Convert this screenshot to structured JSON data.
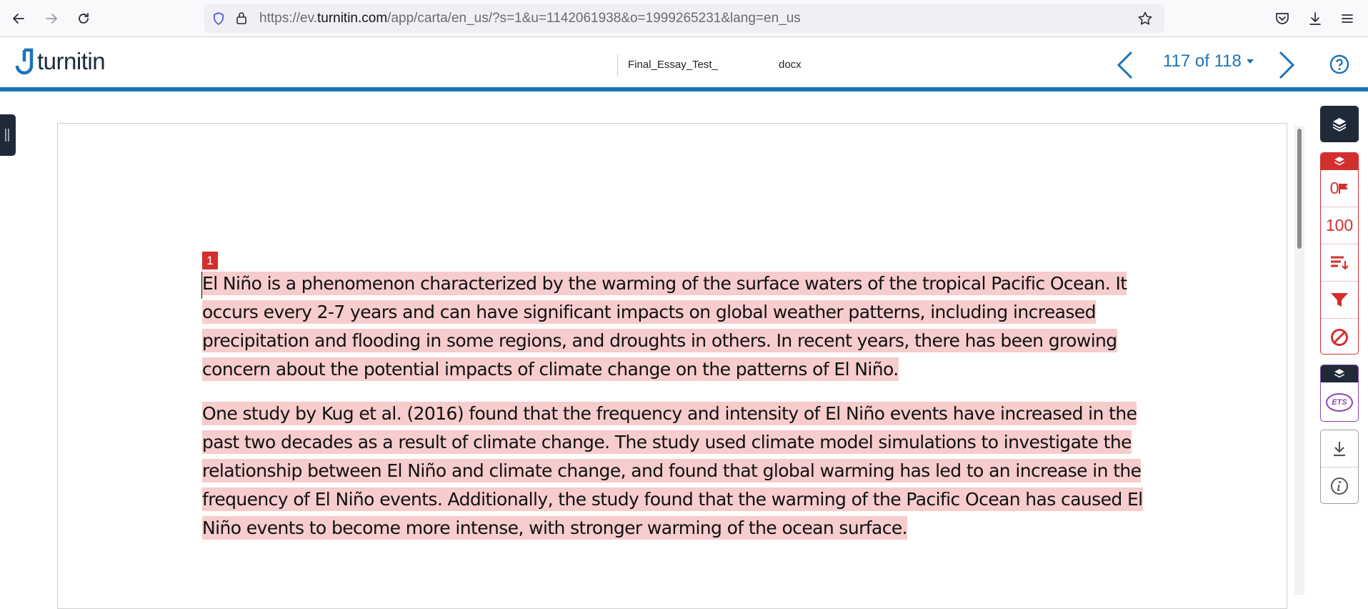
{
  "browser": {
    "url_prefix": "https://ev.",
    "url_domain": "turnitin.com",
    "url_path": "/app/carta/en_us/?s=1&u=1142061938&o=1999265231&lang=en_us"
  },
  "header": {
    "logo_text": "turnitin",
    "file_name_left": "Final_Essay_Test_",
    "file_name_ext": "docx",
    "page_indicator": "117 of 118"
  },
  "document": {
    "match_number": "1",
    "paragraphs": [
      "El Niño is a phenomenon characterized by the warming of the surface waters of the tropical Pacific Ocean. It occurs every 2-7 years and can have significant impacts on global weather patterns, including increased precipitation and flooding in some regions, and droughts in others. In recent years, there has been growing concern about the potential impacts of climate change on the patterns of El Niño.",
      "One study by Kug et al. (2016) found that the frequency and intensity of El Niño events have increased in the past two decades as a result of climate change. The study used climate model simulations to investigate the relationship between El Niño and climate change, and found that global warming has led to an increase in the frequency of El Niño events. Additionally, the study found that the warming of the Pacific Ocean has caused El Niño events to become more intense, with stronger warming of the ocean surface."
    ]
  },
  "sidebar": {
    "flags_count": "0",
    "similarity_score": "100",
    "ets_label": "ETS"
  },
  "colors": {
    "accent_blue": "#1a73b8",
    "similarity_red": "#d32f2f",
    "highlight_pink": "#f6cccc",
    "dark_panel": "#1f2937",
    "ets_purple": "#8e44ad"
  }
}
